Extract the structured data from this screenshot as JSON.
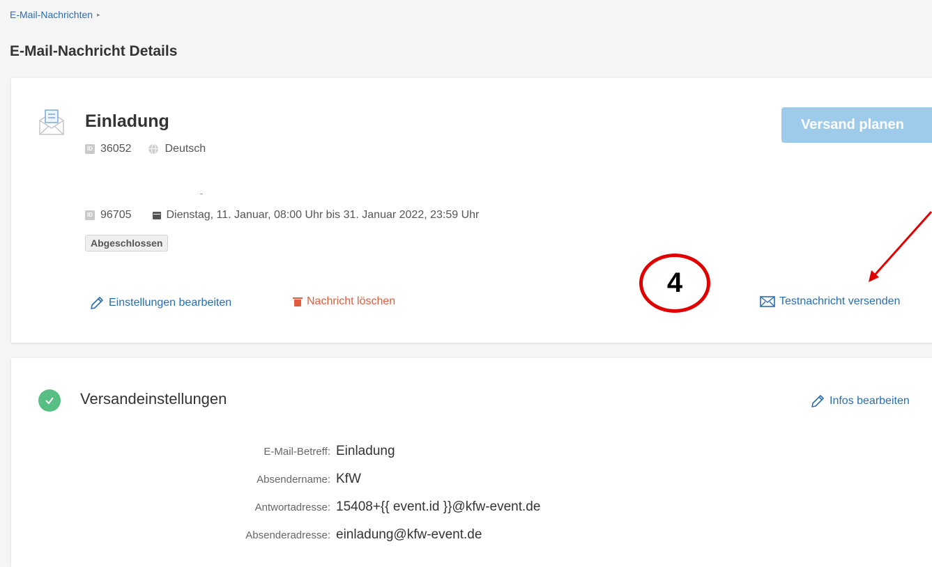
{
  "breadcrumb": {
    "label": "E-Mail-Nachrichten",
    "caret": "▸"
  },
  "page_title": "E-Mail-Nachricht Details",
  "message": {
    "title": "Einladung",
    "id_badge": "ID",
    "id": "36052",
    "language": "Deutsch",
    "event_id": "96705",
    "date_range": "Dienstag, 11. Januar, 08:00 Uhr bis 31. Januar 2022, 23:59 Uhr",
    "status": "Abgeschlossen"
  },
  "actions": {
    "plan_send": "Versand planen",
    "edit_settings": "Einstellungen bearbeiten",
    "delete_message": "Nachricht löschen",
    "send_test": "Testnachricht versenden"
  },
  "annotation": {
    "step": "4",
    "color": "#e00000"
  },
  "send_settings": {
    "title": "Versandeinstellungen",
    "edit_label": "Infos bearbeiten",
    "rows": [
      {
        "label": "E-Mail-Betreff:",
        "value": "Einladung"
      },
      {
        "label": "Absendername:",
        "value": "KfW"
      },
      {
        "label": "Antwortadresse:",
        "value": "15408+{{ event.id }}@kfw-event.de"
      },
      {
        "label": "Absenderadresse:",
        "value": "einladung@kfw-event.de"
      }
    ]
  },
  "colors": {
    "link": "#2a6db0",
    "danger": "#e05c3e",
    "primary_disabled": "#9fcbea",
    "success": "#58bf84"
  }
}
